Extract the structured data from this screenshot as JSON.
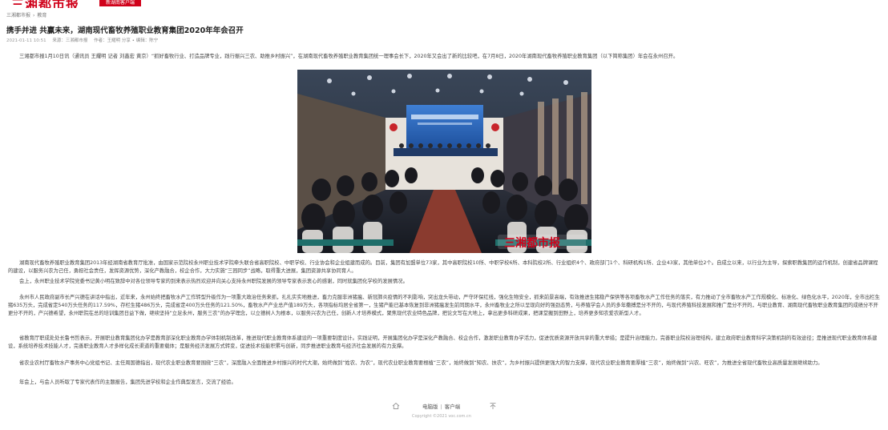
{
  "header": {
    "logo_text": "三湘都市报",
    "logo_tag": "新湖南客户端"
  },
  "breadcrumb": {
    "items": [
      "三湘都市报",
      "教育"
    ]
  },
  "article": {
    "title": "携手并进 共赢未来，湖南现代畜牧养殖职业教育集团2020年年会召开",
    "meta": {
      "datetime": "2021-01-11 10:51",
      "source": "来源：三湘都市报",
      "extra": "作者：王耀明 分享 ∙ 编辑：陈宁"
    },
    "paragraphs": [
      "三湘都市报1月10日讯（通讯员 王耀明 记者 刘鑫宏 黄京）“抓好畜牧行业、打造品牌专业，践行振兴三农、助推乡村振兴”，在湖南现代畜牧养殖职业教育集团统一理事会长下，2020年又会出了新的比较吧，在7月8日，2020年湖南现代畜牧养殖职业教育集团（以下简称集团）年会在永州召开。",
      "湖南现代畜牧养殖职业教育集团2013年经湖南省教育厅批准，由国家示范院校永州职业技术学院牵头联合省高职院校、中职学校、行业协会和企业组建而成的。目前，集团有加盟单位73家，其中高职院校10所、中职学校6所、本科院校2所、行业组织4个、政府部门1个、科研机构1所、企业43家，其他单位2个。自成立以来，以行业为主导，探索职教集团的运作机制，创建省品牌课程的建设，以服务兴农为己任，勇担社会责任，发挥资源优势，深化产教融合，校企合作，大力实施“三园同步”战略，取得重大进展，集团资源共享协同育人。",
      "会上，永州职业技术学院党委书记黄小明在致辞中对各位领导专家的到来表示热烈欢迎并向关心支持永州职院发展的领导专家表示衷心的感谢，同时就集团化学校的发展情况。",
      "永州市人民政府副市长严兴德在讲话中指出，近年来，永州始终把畜牧水产工作转型升级作为一项重大政治任务来抓，扎扎实实地推进，畜力克服非洲猪瘟、新冠肺炎疫情的不利影响，突出龙头带动，严守环保红线，强化生物安全，抓来前景高端，有效推进生猪稳产保供等各项畜牧水产工作任务的落实，有力推动了全市畜牧水产工作规模化、标准化、绿色化水平，2020年，全市出栏生猪635万头，完成省定540万头任务的117.59%，存栏生猪486万头，完成省定400万头任务的121.50%，畜牧水产产业总产值189万头，各项指标均居全省第一，生猪产能已基本恢复到非洲猪瘟发生前同期水平，永州畜牧业之所以呈现向好的强劲态势，与养殖学会人员的多年撒搏是分不开的，与现代养殖科技发展和推广是分不开的，与职业教育、湖南现代畜牧职业教育集团的成绩分不开更分不开的，产兴德希望，永州职院在总的培训集团日益下做，继续坚持“立足永州，服务三农”的办学理念，以立德树人为根本，以服务兴农为己任，创新人才培养模式，聚焦现代农业特色品牌，把论文写在大地上，拿出更多科研成果，把课堂搬到田野上，培养更多知农爱农新型人才。",
      "省教育厅职成处处长鲁书哲表示，开展职业教育集团化办学是教育部深化职业教育办学体制机制改革，推进现代职业教育体系建设的一项重要制度设计。实践证明，开展集团化办学是深化产教融合、校企合作，激发职业教育办学活力，促进优质资源开放共享的重大举措；是提升治理能力，完善职业院校治理结构，建立政府职业教育科学决策机制的有效途径；是推进现代职业教育体系建设，系统培养技术技能人才，完善职业教育人才多样化成长渠道的重要载体；是服务经济发展方式转变，促进技术技能积累与创新，同步推进职业教育与经济社会发展的有力支撑。",
      "省农业农村厅畜牧水产事务中心党组书记、主任周国德指出，现代农业职业教育要围绕“三农”，深度融入全面推进乡村振兴的时代大潮，始终做到“姓农、为农”，现代农业职业教育要根植“三农”，始终做到“知农、扶农”，为乡村振兴提供更强大的智力支撑，现代农业职业教育要厚植“三农”，始终做到“兴农、旺农”，为推进全省现代畜牧业高质量发展继续助力。",
      "年会上，与会人员听取了专家代表作的主题报告，集团先进学校和企业作典型发言，交流了经验。"
    ]
  },
  "photo": {
    "banner_logo": "三湘都市报"
  },
  "footer": {
    "link_pc": "电脑版",
    "link_client": "客户端",
    "copyright": "Copyright ©2021 voc.com.cn"
  }
}
